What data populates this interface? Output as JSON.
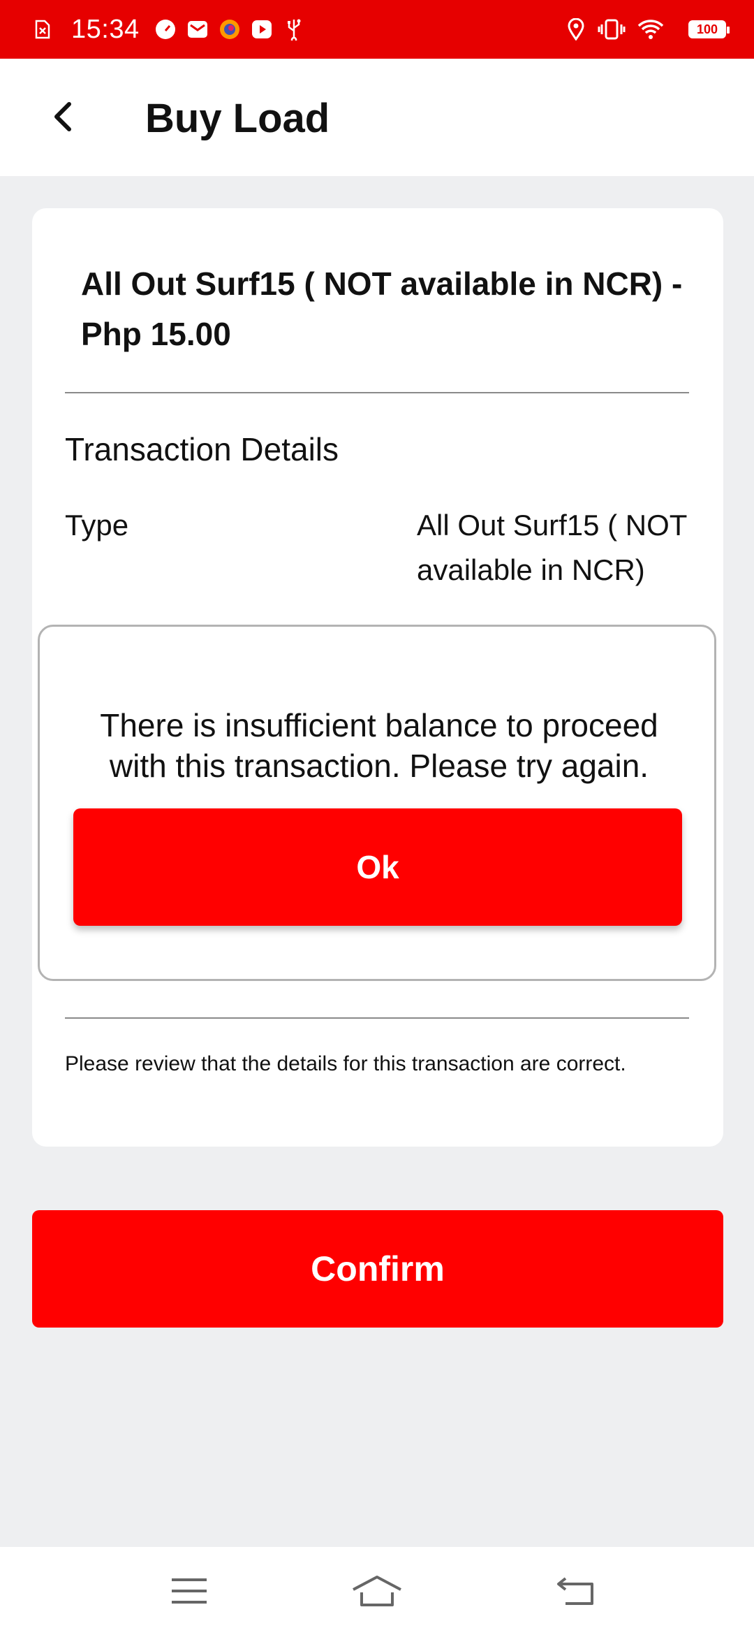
{
  "status_bar": {
    "time": "15:34",
    "battery": "100",
    "left_icons": [
      "sim-error-icon",
      "speedometer-icon",
      "mail-icon",
      "browser-icon",
      "youtube-icon",
      "usb-icon"
    ],
    "right_icons": [
      "location-icon",
      "vibrate-icon",
      "wifi-icon",
      "battery-icon"
    ]
  },
  "app_bar": {
    "title": "Buy Load",
    "back_icon": "chevron-left-icon"
  },
  "card": {
    "product_title": "All Out Surf15 ( NOT available in NCR) - Php 15.00",
    "section_title": "Transaction Details",
    "details": [
      {
        "label": "Type",
        "value": "All Out Surf15 ( NOT available in NCR)"
      }
    ],
    "review_note": "Please review that the details for this transaction are correct."
  },
  "dialog": {
    "message": "There is insufficient balance to proceed with this transaction. Please try again.",
    "ok_label": "Ok"
  },
  "confirm_label": "Confirm",
  "colors": {
    "brand_red": "#ff0000",
    "status_bar_red": "#e60000",
    "background": "#eeeff1"
  },
  "nav_bar": {
    "buttons": [
      "menu-icon",
      "home-icon",
      "back-icon"
    ]
  }
}
